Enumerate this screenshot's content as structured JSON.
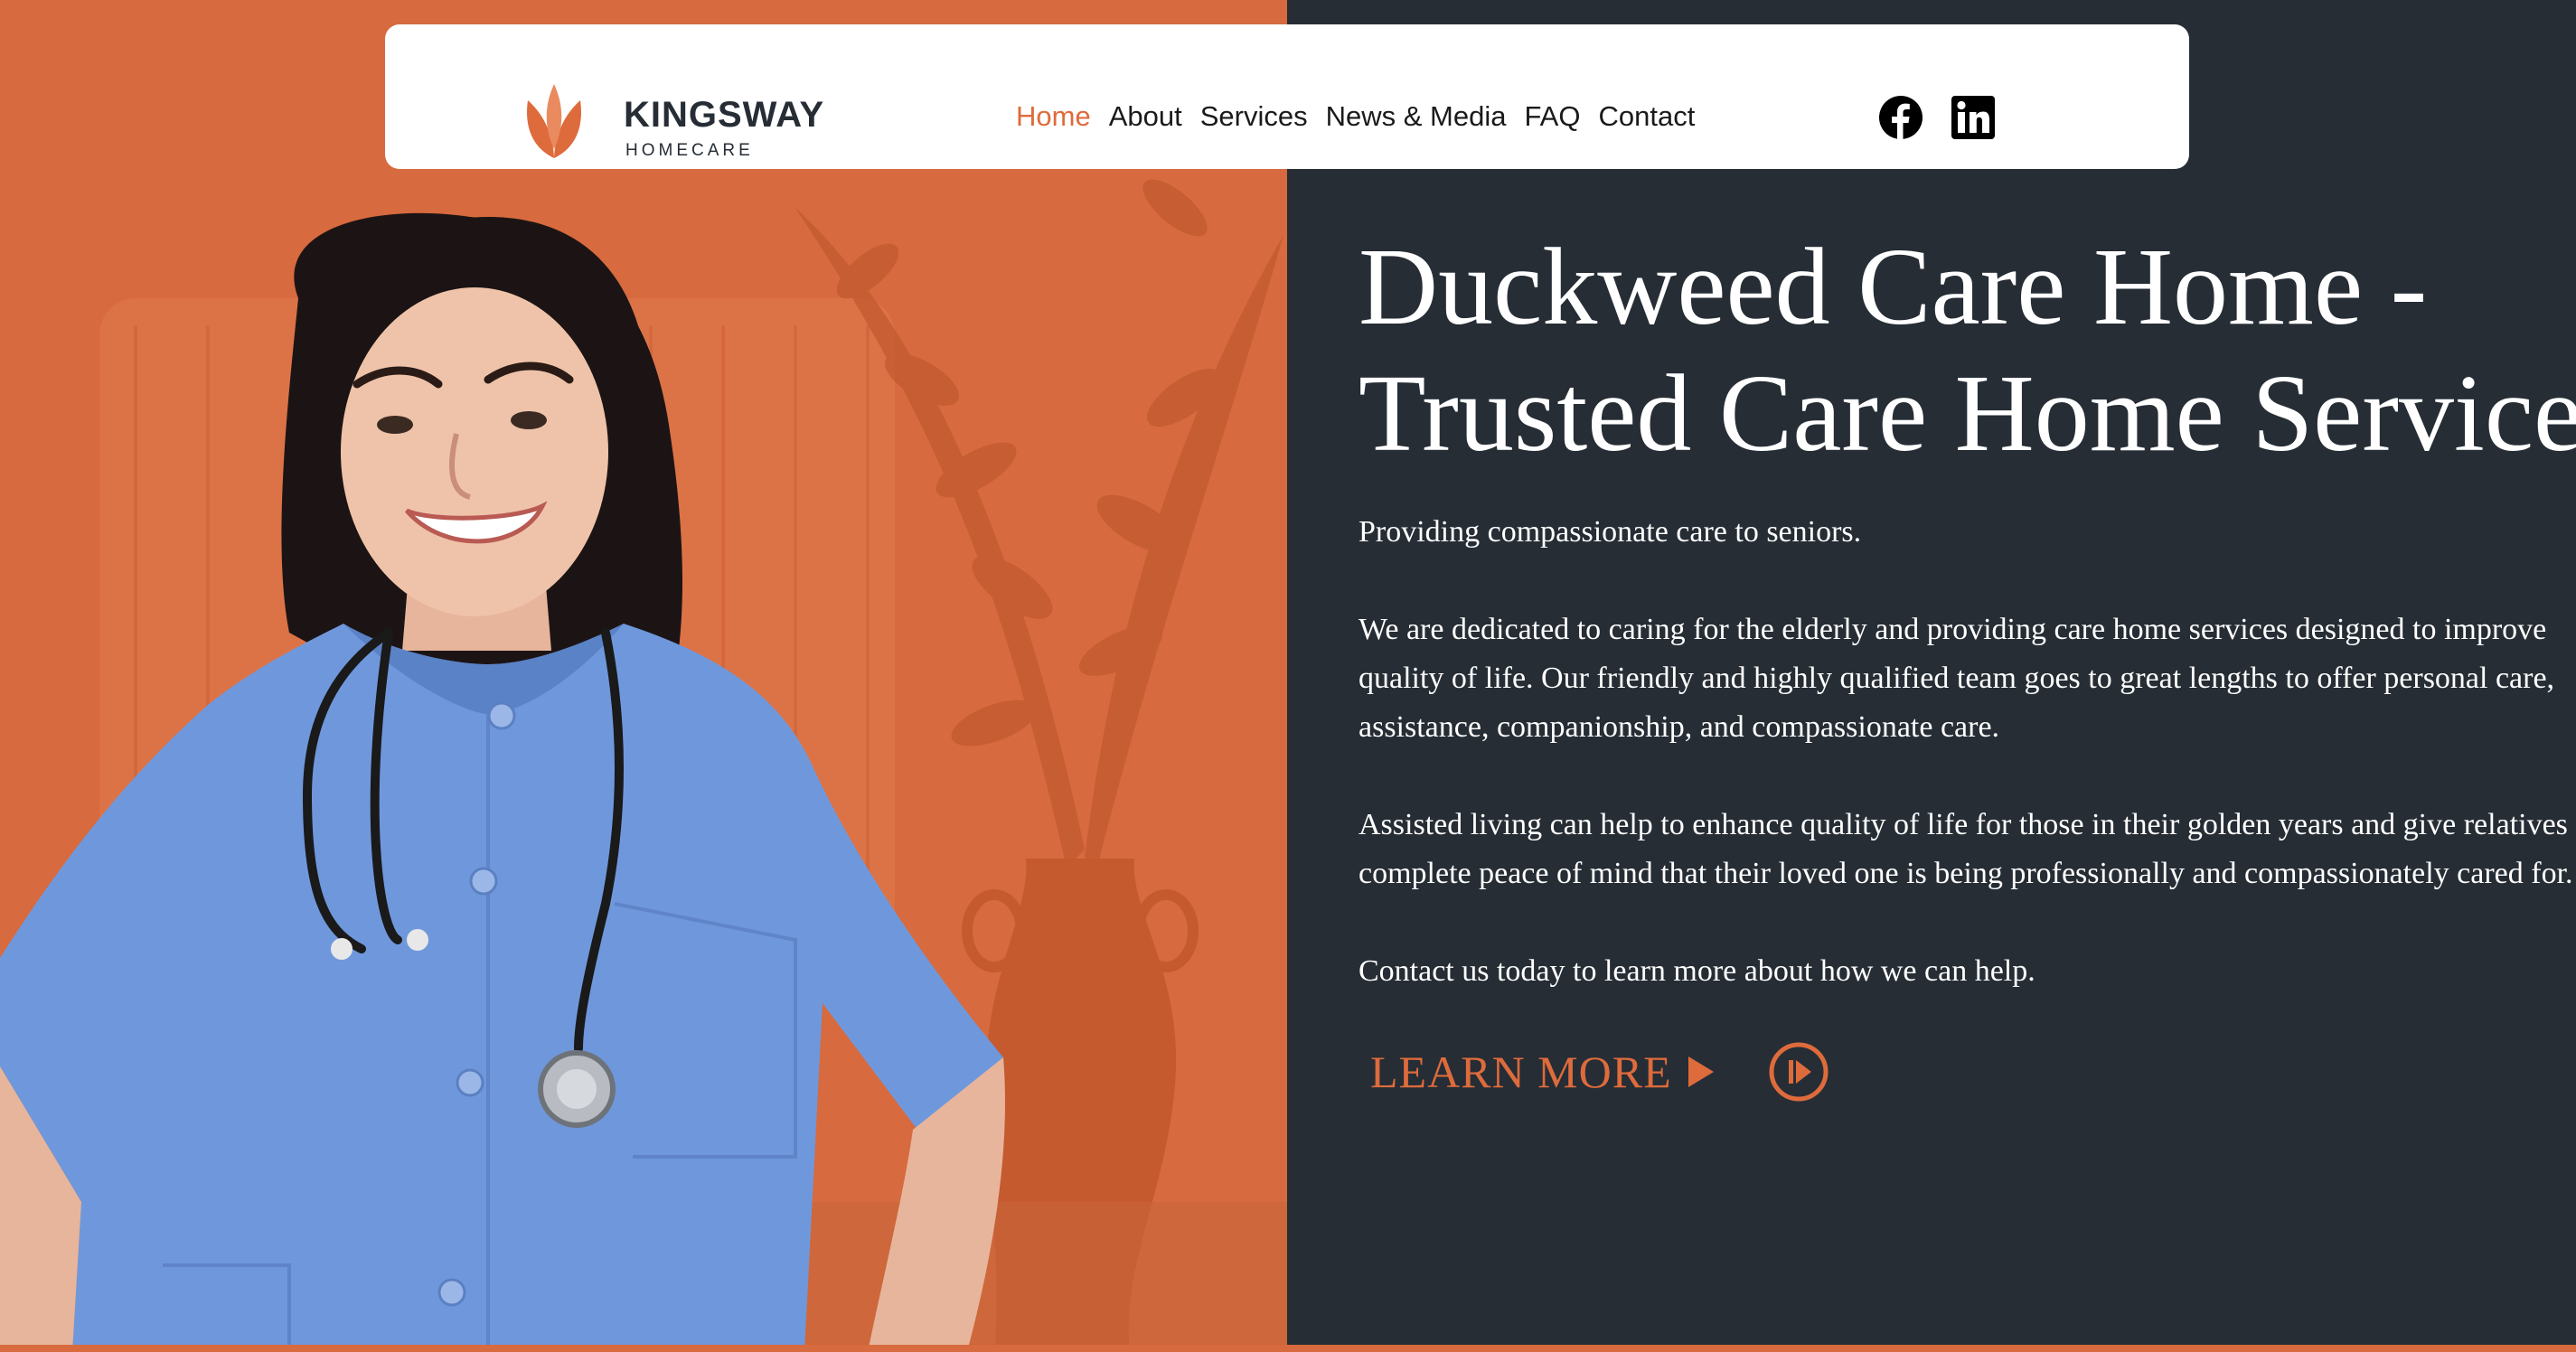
{
  "colors": {
    "accent": "#de6b3c",
    "hero_left_bg": "#d76a3e",
    "hero_right_bg": "#262d35",
    "header_bg": "#ffffff",
    "scrubs": "#6f98dc"
  },
  "header": {
    "logo": {
      "name": "KINGSWAY",
      "sub": "HOMECARE",
      "icon": "leaf-logo-icon"
    },
    "nav": [
      {
        "label": "Home",
        "active": true
      },
      {
        "label": "About",
        "active": false
      },
      {
        "label": "Services",
        "active": false
      },
      {
        "label": "News & Media",
        "active": false
      },
      {
        "label": "FAQ",
        "active": false
      },
      {
        "label": "Contact",
        "active": false
      }
    ],
    "social": [
      {
        "name": "Facebook",
        "icon": "facebook-icon"
      },
      {
        "name": "LinkedIn",
        "icon": "linkedin-icon"
      }
    ]
  },
  "hero": {
    "title_lines": [
      "Duckweed Care Home -",
      "Trusted Care Home Services"
    ],
    "intro": "Providing compassionate care to seniors.",
    "paragraph_1_lines": [
      "We are dedicated to caring for the elderly and providing care home services designed to improve",
      "quality of life. Our friendly and highly qualified team goes to great lengths to offer personal care,",
      "assistance, companionship, and compassionate care."
    ],
    "paragraph_2_lines": [
      "Assisted living can help to enhance quality of life for those in their golden years and give relatives",
      "complete peace of mind that their loved one is being professionally and compassionately cared for."
    ],
    "cta_text": "Contact us today to learn more about how we can help.",
    "learn_more_label": "LEARN MORE",
    "learn_more_icon": "triangle-right-icon",
    "play_icon": "play-circle-icon",
    "image_subject": "smiling nurse in blue scrubs with stethoscope"
  }
}
